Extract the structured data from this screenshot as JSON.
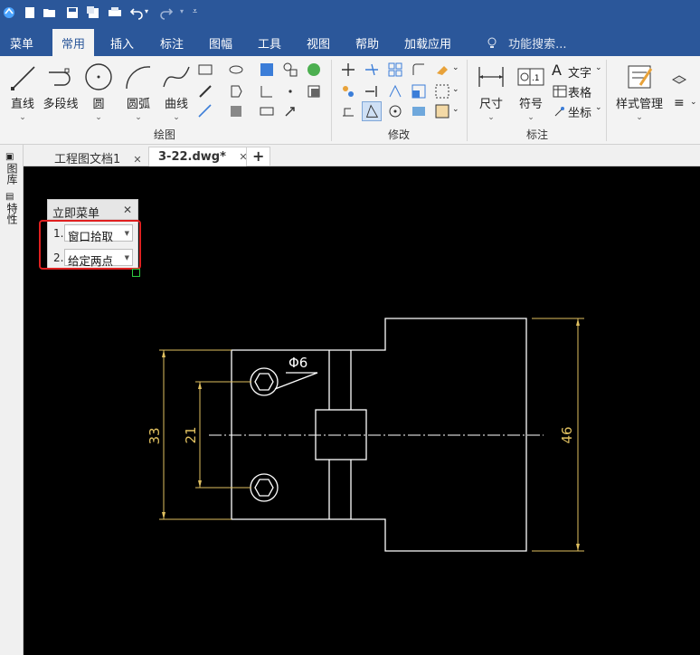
{
  "menubar": {
    "items": [
      "菜单",
      "常用",
      "插入",
      "标注",
      "图幅",
      "工具",
      "视图",
      "帮助",
      "加载应用"
    ],
    "active": "常用",
    "search_placeholder": "功能搜索..."
  },
  "ribbon": {
    "groups": {
      "draw": "绘图",
      "modify": "修改",
      "dimension": "标注"
    },
    "tools": {
      "line": "直线",
      "polyline": "多段线",
      "circle": "圆",
      "arc": "圆弧",
      "curve": "曲线",
      "dimension": "尺寸",
      "symbol": "符号",
      "text": "文字",
      "table": "表格",
      "coordinate": "坐标",
      "style_manager": "样式管理"
    }
  },
  "doc_tabs": [
    {
      "label": "工程图文档1",
      "active": false
    },
    {
      "label": "3-22.dwg*",
      "active": true
    }
  ],
  "side_tabs": [
    "图库",
    "特性"
  ],
  "immediate_menu": {
    "title": "立即菜单",
    "rows": [
      {
        "num": "1.",
        "value": "窗口拾取"
      },
      {
        "num": "2.",
        "value": "给定两点"
      }
    ]
  },
  "drawing": {
    "dims": {
      "d1": "Φ6",
      "d2": "33",
      "d3": "21",
      "d4": "46"
    }
  },
  "colors": {
    "title_blue": "#2b579a",
    "canvas_bg": "#000000",
    "geometry": "#ffffff",
    "dimension": "#e0c060",
    "highlight": "#e02020"
  }
}
